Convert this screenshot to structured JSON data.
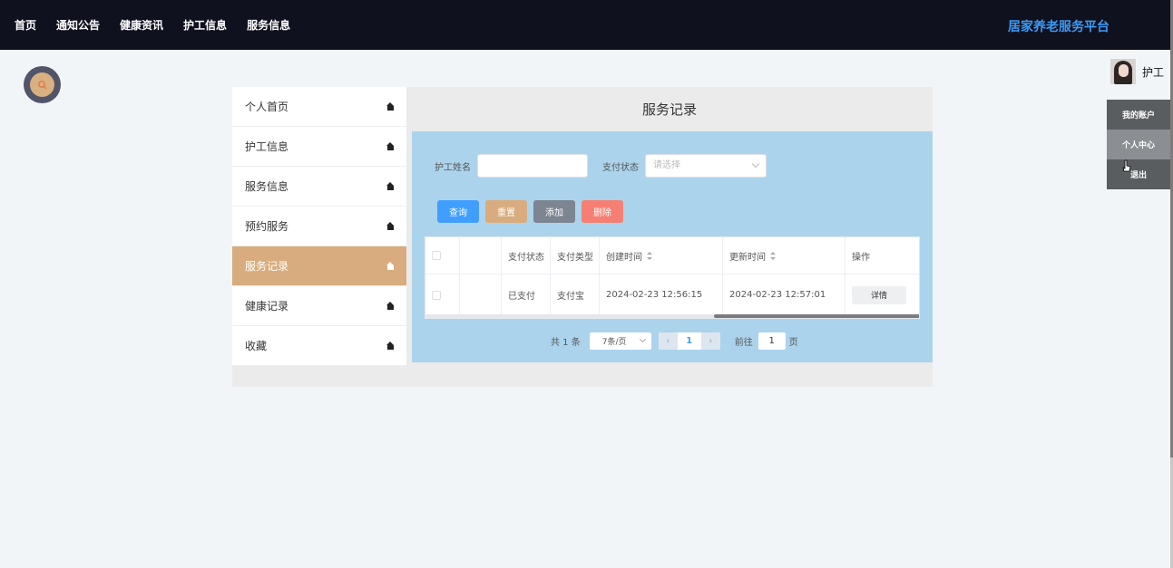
{
  "nav": {
    "items": [
      "首页",
      "通知公告",
      "健康资讯",
      "护工信息",
      "服务信息"
    ],
    "brand": "居家养老服务平台"
  },
  "user": {
    "name": "护工",
    "menu": [
      "我的账户",
      "个人中心",
      "退出"
    ],
    "active_menu": "个人中心"
  },
  "sidebar": {
    "items": [
      {
        "label": "个人首页"
      },
      {
        "label": "护工信息"
      },
      {
        "label": "服务信息"
      },
      {
        "label": "预约服务"
      },
      {
        "label": "服务记录"
      },
      {
        "label": "健康记录"
      },
      {
        "label": "收藏"
      }
    ],
    "active": "服务记录"
  },
  "page": {
    "title": "服务记录"
  },
  "filters": {
    "name_label": "护工姓名",
    "name_value": "",
    "status_label": "支付状态",
    "status_placeholder": "请选择"
  },
  "buttons": {
    "query": "查询",
    "reset": "重置",
    "add": "添加",
    "delete": "删除"
  },
  "table": {
    "headers": [
      "",
      "",
      "支付状态",
      "支付类型",
      "创建时间",
      "更新时间",
      "操作"
    ],
    "rows": [
      {
        "pay_status": "已支付",
        "pay_type": "支付宝",
        "created": "2024-02-23 12:56:15",
        "updated": "2024-02-23 12:57:01",
        "action": "详情"
      }
    ]
  },
  "pagination": {
    "total": "共 1 条",
    "page_size": "7条/页",
    "current": "1",
    "goto_label": "前往",
    "goto_value": "1",
    "goto_suffix": "页"
  },
  "colors": {
    "topbar": "#10111f",
    "brand": "#3c9af5",
    "accent": "#d8ac7e",
    "content_bg": "#acd3ec",
    "query": "#409eff",
    "add": "#7c8591",
    "delete": "#f57f73"
  }
}
